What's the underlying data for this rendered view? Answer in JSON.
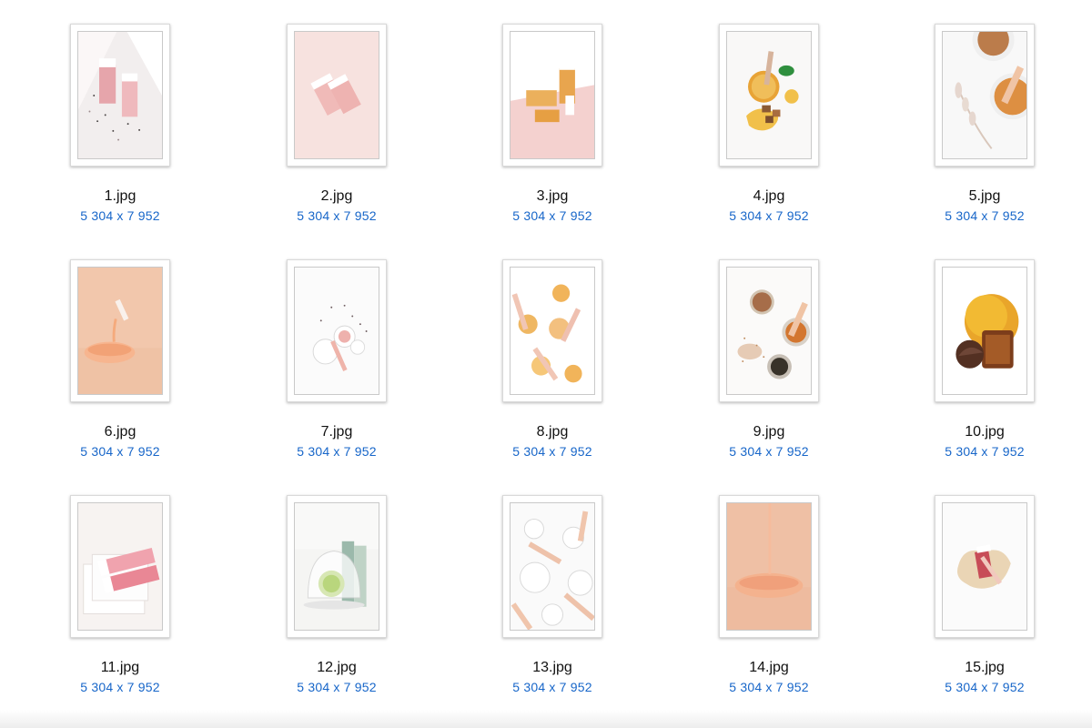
{
  "files": [
    {
      "name": "1.jpg",
      "dims": "5 304 x 7 952",
      "accent": "#e8a6ad"
    },
    {
      "name": "2.jpg",
      "dims": "5 304 x 7 952",
      "accent": "#f1c3c0"
    },
    {
      "name": "3.jpg",
      "dims": "5 304 x 7 952",
      "accent": "#e8a64a"
    },
    {
      "name": "4.jpg",
      "dims": "5 304 x 7 952",
      "accent": "#e9a53a"
    },
    {
      "name": "5.jpg",
      "dims": "5 304 x 7 952",
      "accent": "#e9a86b"
    },
    {
      "name": "6.jpg",
      "dims": "5 304 x 7 952",
      "accent": "#f3c09b"
    },
    {
      "name": "7.jpg",
      "dims": "5 304 x 7 952",
      "accent": "#e6a8a8"
    },
    {
      "name": "8.jpg",
      "dims": "5 304 x 7 952",
      "accent": "#efb45d"
    },
    {
      "name": "9.jpg",
      "dims": "5 304 x 7 952",
      "accent": "#d7833c"
    },
    {
      "name": "10.jpg",
      "dims": "5 304 x 7 952",
      "accent": "#e7a11a"
    },
    {
      "name": "11.jpg",
      "dims": "5 304 x 7 952",
      "accent": "#e58b99"
    },
    {
      "name": "12.jpg",
      "dims": "5 304 x 7 952",
      "accent": "#8fb5a6"
    },
    {
      "name": "13.jpg",
      "dims": "5 304 x 7 952",
      "accent": "#e6bca8"
    },
    {
      "name": "14.jpg",
      "dims": "5 304 x 7 952",
      "accent": "#e5a07b"
    },
    {
      "name": "15.jpg",
      "dims": "5 304 x 7 952",
      "accent": "#c64c58"
    }
  ]
}
